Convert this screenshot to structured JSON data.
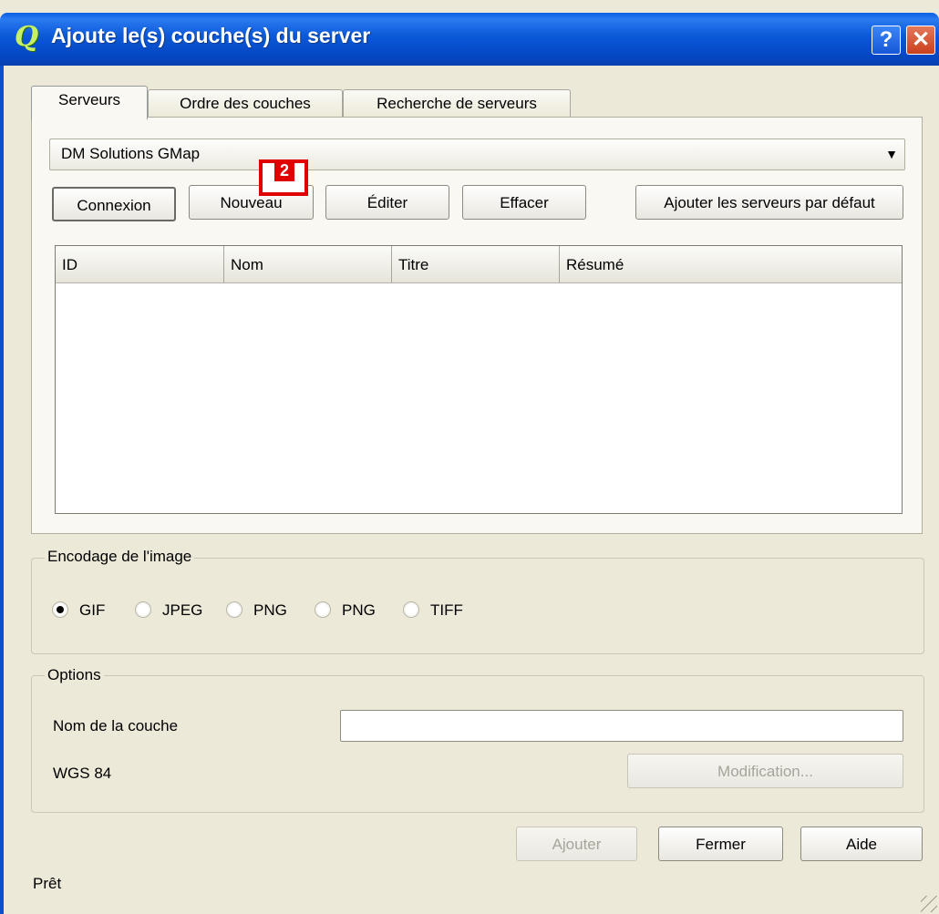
{
  "window": {
    "title": "Ajoute le(s) couche(s) du server",
    "app_icon_glyph": "Q",
    "help_glyph": "?",
    "close_glyph": "✕"
  },
  "tabs": [
    {
      "label": "Serveurs",
      "active": true
    },
    {
      "label": "Ordre des couches",
      "active": false
    },
    {
      "label": "Recherche de serveurs",
      "active": false
    }
  ],
  "servers": {
    "selected": "DM Solutions GMap",
    "dropdown_arrow": "▼",
    "buttons": {
      "connect": "Connexion",
      "new": "Nouveau",
      "edit": "Éditer",
      "delete": "Effacer",
      "add_default": "Ajouter les serveurs par défaut"
    },
    "annotation_marker": "2"
  },
  "table": {
    "columns": [
      "ID",
      "Nom",
      "Titre",
      "Résumé"
    ],
    "rows": []
  },
  "encoding": {
    "title": "Encodage de l'image",
    "options": [
      {
        "label": "GIF",
        "selected": true
      },
      {
        "label": "JPEG",
        "selected": false
      },
      {
        "label": "PNG",
        "selected": false
      },
      {
        "label": "PNG",
        "selected": false
      },
      {
        "label": "TIFF",
        "selected": false
      }
    ]
  },
  "options": {
    "title": "Options",
    "layer_name_label": "Nom de la couche",
    "layer_name_value": "",
    "crs_label": "WGS 84",
    "modify_button": "Modification..."
  },
  "footer": {
    "add": "Ajouter",
    "close": "Fermer",
    "help": "Aide",
    "status": "Prêt"
  }
}
